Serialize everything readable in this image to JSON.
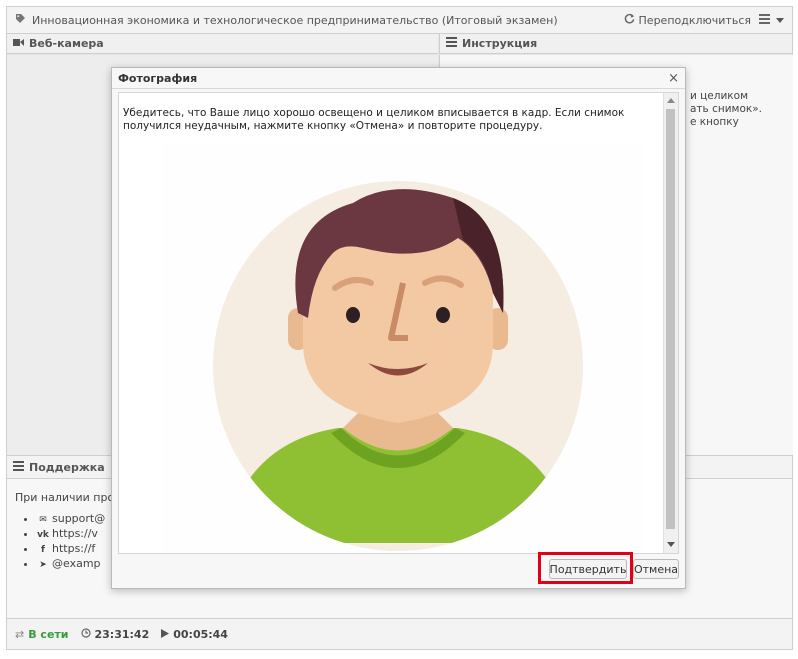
{
  "header": {
    "title": "Инновационная экономика и технологическое предпринимательство (Итоговый экзамен)",
    "reconnect_label": "Переподключиться"
  },
  "panels": {
    "webcam_title": "Веб-камера",
    "instructions_title": "Инструкция",
    "instructions_fragment": [
      "и целиком",
      "ать снимок».",
      "е кнопку"
    ]
  },
  "support": {
    "title": "Поддержка",
    "intro": "При наличии проб",
    "links": [
      {
        "icon": "envelope-icon",
        "text": "support@"
      },
      {
        "icon": "vk-icon",
        "text": "https://v"
      },
      {
        "icon": "facebook-icon",
        "text": "https://f"
      },
      {
        "icon": "telegram-icon",
        "text": "@examp"
      }
    ]
  },
  "status": {
    "online_label": "В сети",
    "clock": "23:31:42",
    "elapsed": "00:05:44"
  },
  "dialog": {
    "title": "Фотография",
    "close_symbol": "×",
    "text": "Убедитесь, что Ваше лицо хорошо освещено и целиком вписывается в кадр. Если снимок получился неудачным, нажмите кнопку «Отмена» и повторите процедуру.",
    "confirm_label": "Подтвердить",
    "cancel_label": "Отмена"
  },
  "colors": {
    "highlight": "#e00018",
    "online": "#3a9b3a",
    "avatar_bg": "#f5ece2",
    "hair": "#6b3740",
    "skin": "#f2c9a2",
    "shirt": "#8fc034"
  }
}
